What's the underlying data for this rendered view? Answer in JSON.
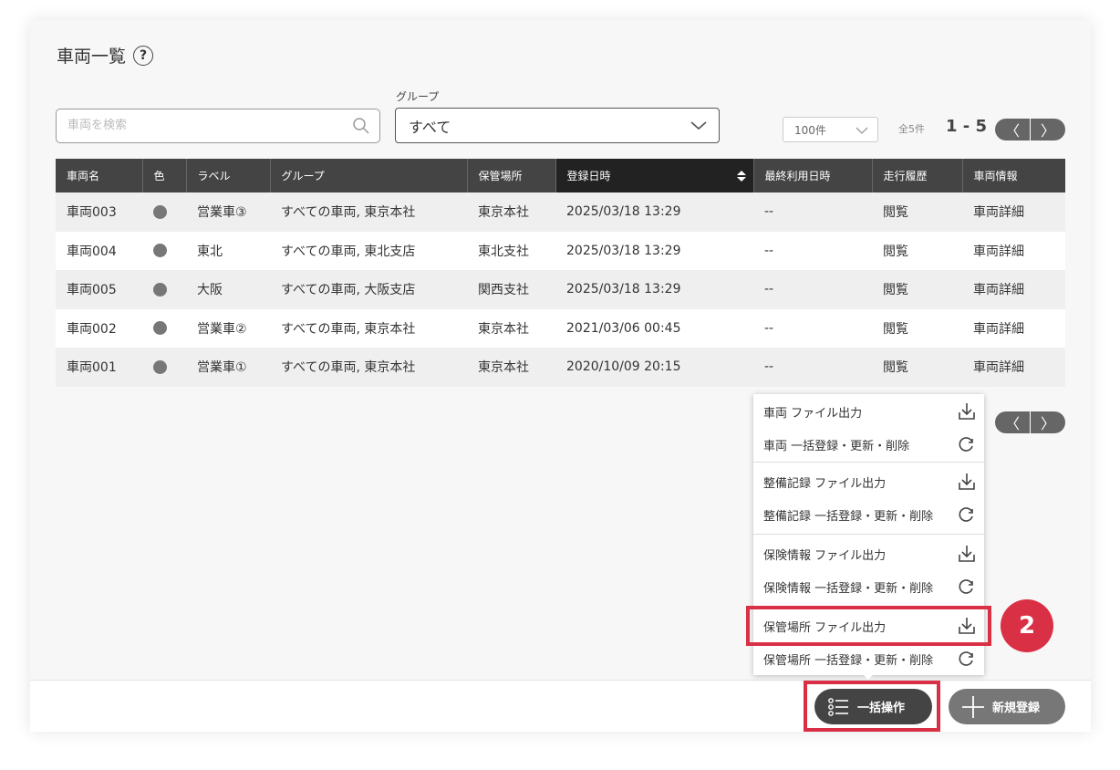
{
  "page": {
    "title": "車両一覧",
    "help_icon": "?"
  },
  "search": {
    "placeholder": "車両を検索"
  },
  "group_filter": {
    "label": "グループ",
    "value": "すべて"
  },
  "pagination": {
    "per_page": "100件",
    "total": "全5件",
    "range": "1 - 5",
    "prev": "〈",
    "next": "〉"
  },
  "table": {
    "headers": [
      "車両名",
      "色",
      "ラベル",
      "グループ",
      "保管場所",
      "登録日時",
      "最終利用日時",
      "走行履歴",
      "車両情報"
    ],
    "sorted_column": "登録日時",
    "rows": [
      {
        "name": "車両003",
        "label": "営業車③",
        "group": "すべての車両, 東京本社",
        "location": "東京本社",
        "registered": "2025/03/18 13:29",
        "last_used": "--",
        "history": "閲覧",
        "info": "車両詳細"
      },
      {
        "name": "車両004",
        "label": "東北",
        "group": "すべての車両, 東北支店",
        "location": "東北支社",
        "registered": "2025/03/18 13:29",
        "last_used": "--",
        "history": "閲覧",
        "info": "車両詳細"
      },
      {
        "name": "車両005",
        "label": "大阪",
        "group": "すべての車両, 大阪支店",
        "location": "関西支社",
        "registered": "2025/03/18 13:29",
        "last_used": "--",
        "history": "閲覧",
        "info": "車両詳細"
      },
      {
        "name": "車両002",
        "label": "営業車②",
        "group": "すべての車両, 東京本社",
        "location": "東京本社",
        "registered": "2021/03/06 00:45",
        "last_used": "--",
        "history": "閲覧",
        "info": "車両詳細"
      },
      {
        "name": "車両001",
        "label": "営業車①",
        "group": "すべての車両, 東京本社",
        "location": "東京本社",
        "registered": "2020/10/09 20:15",
        "last_used": "--",
        "history": "閲覧",
        "info": "車両詳細"
      }
    ]
  },
  "bulk_menu": {
    "items": [
      {
        "label": "車両 ファイル出力",
        "icon": "download-icon"
      },
      {
        "label": "車両 一括登録・更新・削除",
        "icon": "refresh-icon"
      },
      {
        "label": "整備記録 ファイル出力",
        "icon": "download-icon"
      },
      {
        "label": "整備記録 一括登録・更新・削除",
        "icon": "refresh-icon"
      },
      {
        "label": "保険情報 ファイル出力",
        "icon": "download-icon"
      },
      {
        "label": "保険情報 一括登録・更新・削除",
        "icon": "refresh-icon"
      },
      {
        "label": "保管場所 ファイル出力",
        "icon": "download-icon"
      },
      {
        "label": "保管場所 一括登録・更新・削除",
        "icon": "refresh-icon"
      }
    ]
  },
  "annotation": {
    "step_number": "2",
    "color": "#d93045"
  },
  "footer": {
    "bulk_button": "一括操作",
    "new_button": "新規登録"
  }
}
